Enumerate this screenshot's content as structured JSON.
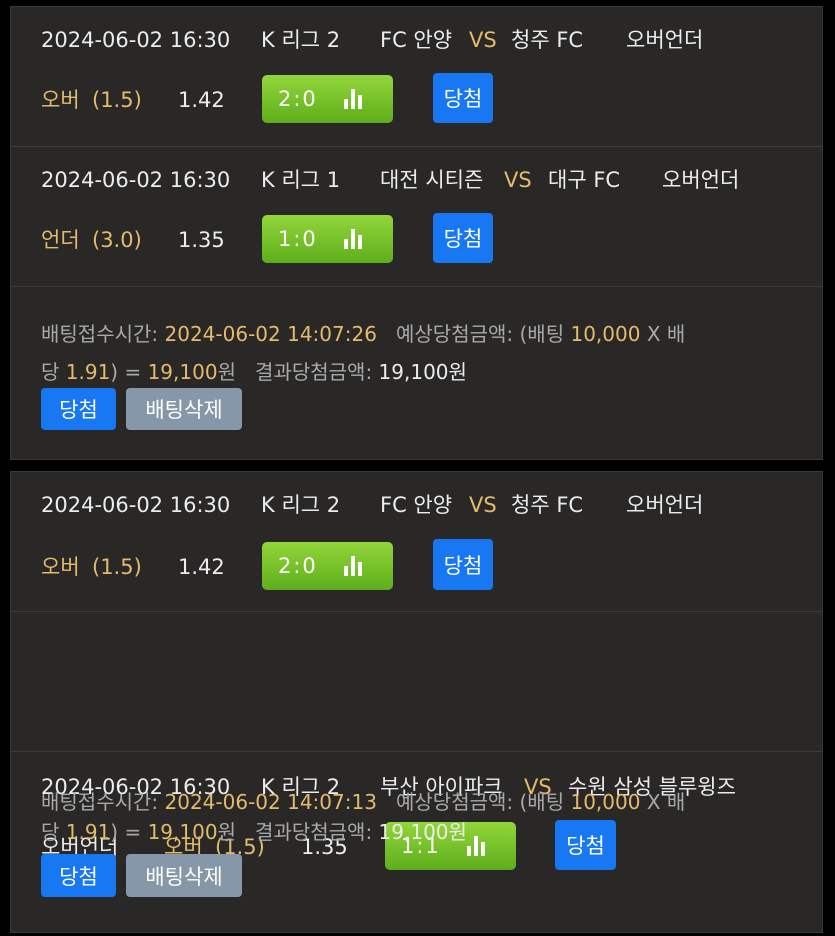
{
  "slips": [
    {
      "matches": [
        {
          "datetime": "2024-06-02 16:30",
          "league": "K 리그 2",
          "home": "FC 안양",
          "vs": "VS",
          "away": "청주 FC",
          "market": "오버언더",
          "pick": "오버",
          "line": "(1.5)",
          "odds": "1.42",
          "score": "2:0",
          "result": "당첨"
        },
        {
          "datetime": "2024-06-02 16:30",
          "league": "K 리그 1",
          "home": "대전 시티즌",
          "vs": "VS",
          "away": "대구 FC",
          "market": "오버언더",
          "pick": "언더",
          "line": "(3.0)",
          "odds": "1.35",
          "score": "1:0",
          "result": "당첨"
        }
      ],
      "summary": {
        "time_label": "배팅접수시간:",
        "time": "2024-06-02  14:07:26",
        "expected_label": "예상당첨금액: (배팅",
        "stake": "10,000",
        "x": "X",
        "bae": "배",
        "dang": "당",
        "total_odds": "1.91",
        ") = ": ") =",
        "expected": "19,100",
        "won": "원",
        "result_label": "결과당첨금액:",
        "result_amount": "19,100원"
      },
      "buttons": {
        "win": "당첨",
        "delete": "배팅삭제"
      }
    },
    {
      "matches": [
        {
          "datetime": "2024-06-02 16:30",
          "league": "K 리그 2",
          "home": "FC 안양",
          "vs": "VS",
          "away": "청주 FC",
          "market": "오버언더",
          "pick": "오버",
          "line": "(1.5)",
          "odds": "1.42",
          "score": "2:0",
          "result": "당첨"
        },
        {
          "datetime": "2024-06-02 16:30",
          "league": "K 리그 2",
          "home": "부산 아이파크",
          "vs": "VS",
          "away": "수원 삼성 블루윙즈",
          "market": "오버언더",
          "pick": "오버",
          "line": "(1.5)",
          "odds": "1.35",
          "score": "1:1",
          "result": "당첨"
        }
      ],
      "summary": {
        "time_label": "배팅접수시간:",
        "time": "2024-06-02  14:07:13",
        "expected_label": "예상당첨금액: (배팅",
        "stake": "10,000",
        "x": "X",
        "bae": "배",
        "dang": "당",
        "total_odds": "1.91",
        ") = ": ") =",
        "expected": "19,100",
        "won": "원",
        "result_label": "결과당첨금액:",
        "result_amount": "19,100원"
      },
      "buttons": {
        "win": "당첨",
        "delete": "배팅삭제"
      }
    }
  ],
  "icons": {
    "stats": "bar-chart-icon"
  },
  "colors": {
    "accent_gold": "#e3bb6d",
    "win_blue": "#1877f2",
    "score_green": "#7cc42c",
    "delete_gray": "#8597a8",
    "panel": "#292827"
  }
}
